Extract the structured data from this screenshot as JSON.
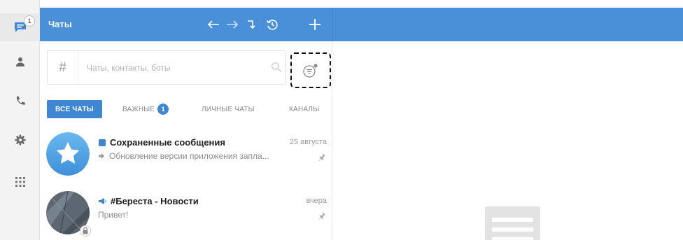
{
  "rail": {
    "items": [
      {
        "icon": "chat-bubble-icon",
        "badge": "1"
      },
      {
        "icon": "person-icon"
      },
      {
        "icon": "phone-icon"
      },
      {
        "icon": "gear-icon"
      },
      {
        "icon": "apps-grid-icon"
      }
    ]
  },
  "header": {
    "title": "Чаты",
    "icons": [
      "arrow-left-icon",
      "arrow-right-icon",
      "turn-down-icon",
      "history-icon",
      "plus-icon"
    ]
  },
  "search": {
    "prefix": "#",
    "placeholder": "Чаты, контакты, боты",
    "value": ""
  },
  "tabs": [
    {
      "label": "ВСЕ ЧАТЫ",
      "active": true
    },
    {
      "label": "ВАЖНЫЕ",
      "count": "1"
    },
    {
      "label": "ЛИЧНЫЕ ЧАТЫ"
    },
    {
      "label": "КАНАЛЫ"
    }
  ],
  "chats": [
    {
      "title": "Сохраненные сообщения",
      "date": "25 августа",
      "preview": "Обновление версии приложения запла...",
      "pinned": true
    },
    {
      "title": "#Береста - Новости",
      "date": "вчера",
      "preview": "Привет!",
      "pinned": true
    }
  ],
  "colors": {
    "accent": "#4a90d9",
    "tab_active": "#3f86d3",
    "rail_bg": "#f3f3f3"
  }
}
